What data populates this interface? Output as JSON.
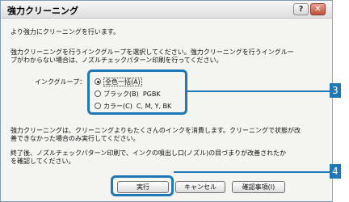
{
  "window": {
    "title": "強力クリーニング"
  },
  "titlebar": {
    "help_label": "?",
    "close_label": "✕"
  },
  "body": {
    "intro": "より強力にクリーニングを行います。",
    "instruction_line1": "強力クリーニングを行うインクグループを選択してください。強力クリーニングを行うイングルー",
    "instruction_line2": "プがわからない場合は、ノズルチェックパターン印刷を行ってください。",
    "ink_group_label": "インクグループ：",
    "warning_line1": "強力クリーニングは、クリーニングよりもたくさんのインクを消費します。クリーニングで状態が改",
    "warning_line2": "善できなかった場合のみ実行してください。",
    "after_line1": "終了後、ノズルチェックパターン印刷で、インクの噴出し口(ノズル)の目づまりが改善されたか",
    "after_line2": "を確認してください。"
  },
  "ink_groups": [
    {
      "label": "全色一括(A)",
      "extra": "",
      "selected": true
    },
    {
      "label": "ブラック(B)",
      "extra": "PGBK",
      "selected": false
    },
    {
      "label": "カラー(C)",
      "extra": "C, M, Y, BK",
      "selected": false
    }
  ],
  "buttons": {
    "execute": "実行",
    "cancel": "キャンセル",
    "confirm": "確認事項(I)"
  },
  "callouts": {
    "ink_group": "3",
    "execute": "4"
  },
  "colors": {
    "callout": "#1e78b8"
  }
}
